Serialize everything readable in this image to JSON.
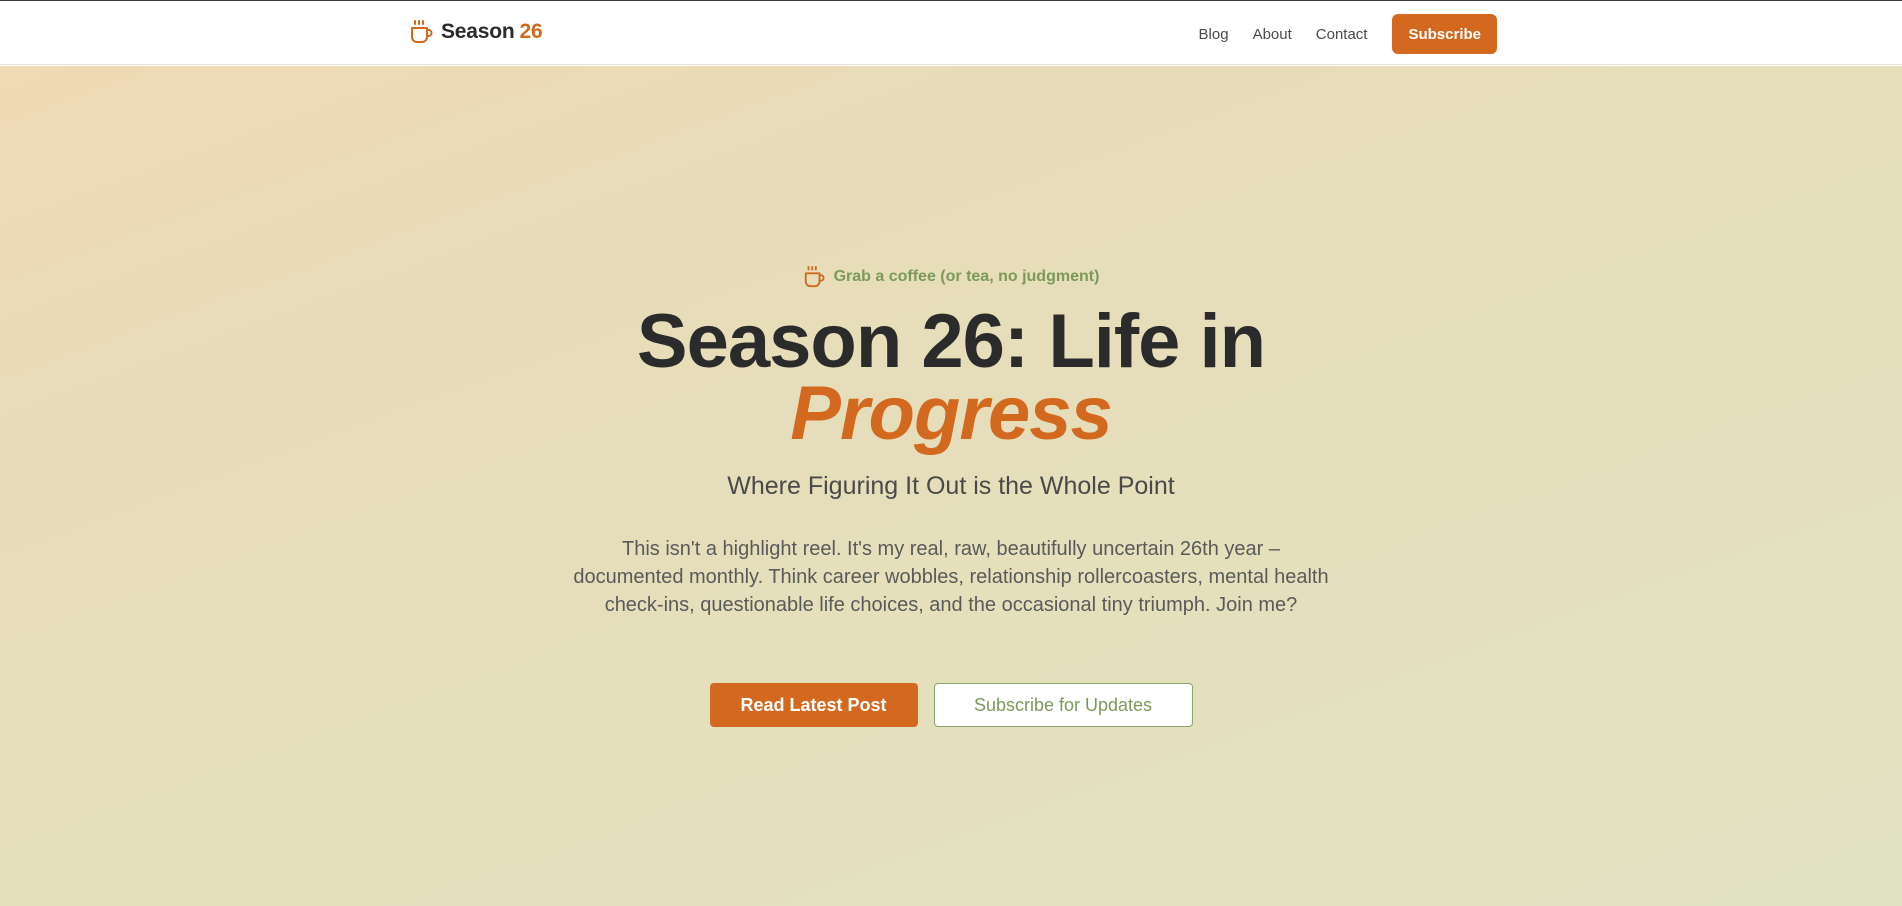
{
  "header": {
    "brand_name": "Season",
    "brand_accent": "26",
    "brand_icon": "coffee-cup-icon",
    "nav": [
      {
        "label": "Blog"
      },
      {
        "label": "About"
      },
      {
        "label": "Contact"
      }
    ],
    "subscribe_label": "Subscribe"
  },
  "hero": {
    "tagline_icon": "coffee-cup-icon",
    "tagline": "Grab a coffee (or tea, no judgment)",
    "headline_main": "Season 26: Life in",
    "headline_accent": "Progress",
    "subtitle": "Where Figuring It Out is the Whole Point",
    "description": "This isn't a highlight reel. It's my real, raw, beautifully uncertain 26th year – documented monthly. Think career wobbles, relationship rollercoasters, mental health check-ins, questionable life choices, and the occasional tiny triumph. Join me?",
    "primary_cta": "Read Latest Post",
    "secondary_cta": "Subscribe for Updates"
  },
  "colors": {
    "accent": "#d2691e",
    "sage": "#7c9a5a",
    "text_dark": "#2b2b2b"
  }
}
